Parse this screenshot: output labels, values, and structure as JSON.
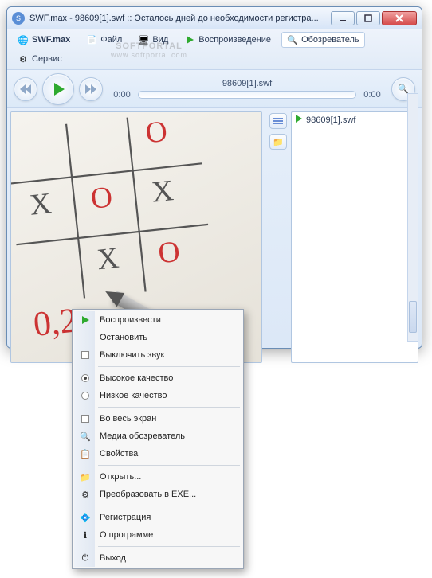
{
  "window": {
    "title": "SWF.max - 98609[1].swf :: Осталось дней до необходимости регистра..."
  },
  "toolbar": {
    "app": "SWF.max",
    "file": "Файл",
    "view": "Вид",
    "playback": "Воспроизведение",
    "browser": "Обозреватель",
    "service": "Сервис"
  },
  "watermark": {
    "line1": "SOFTPORTAL",
    "line2": "www.softportal.com"
  },
  "player": {
    "filename": "98609[1].swf",
    "time_start": "0:00",
    "time_end": "0:00"
  },
  "playlist": {
    "items": [
      {
        "label": "98609[1].swf"
      }
    ]
  },
  "context_menu": {
    "play": "Воспроизвести",
    "stop": "Остановить",
    "mute": "Выключить звук",
    "high_q": "Высокое качество",
    "low_q": "Низкое качество",
    "fullscreen": "Во весь экран",
    "media_browser": "Медиа обозреватель",
    "properties": "Свойства",
    "open": "Открыть...",
    "to_exe": "Преобразовать в EXE...",
    "register": "Регистрация",
    "about": "О программе",
    "exit": "Выход"
  },
  "icons": {
    "play_color": "#2faa2f",
    "folder_color": "#e6b84a",
    "magnifier_color": "#3a6db5"
  }
}
